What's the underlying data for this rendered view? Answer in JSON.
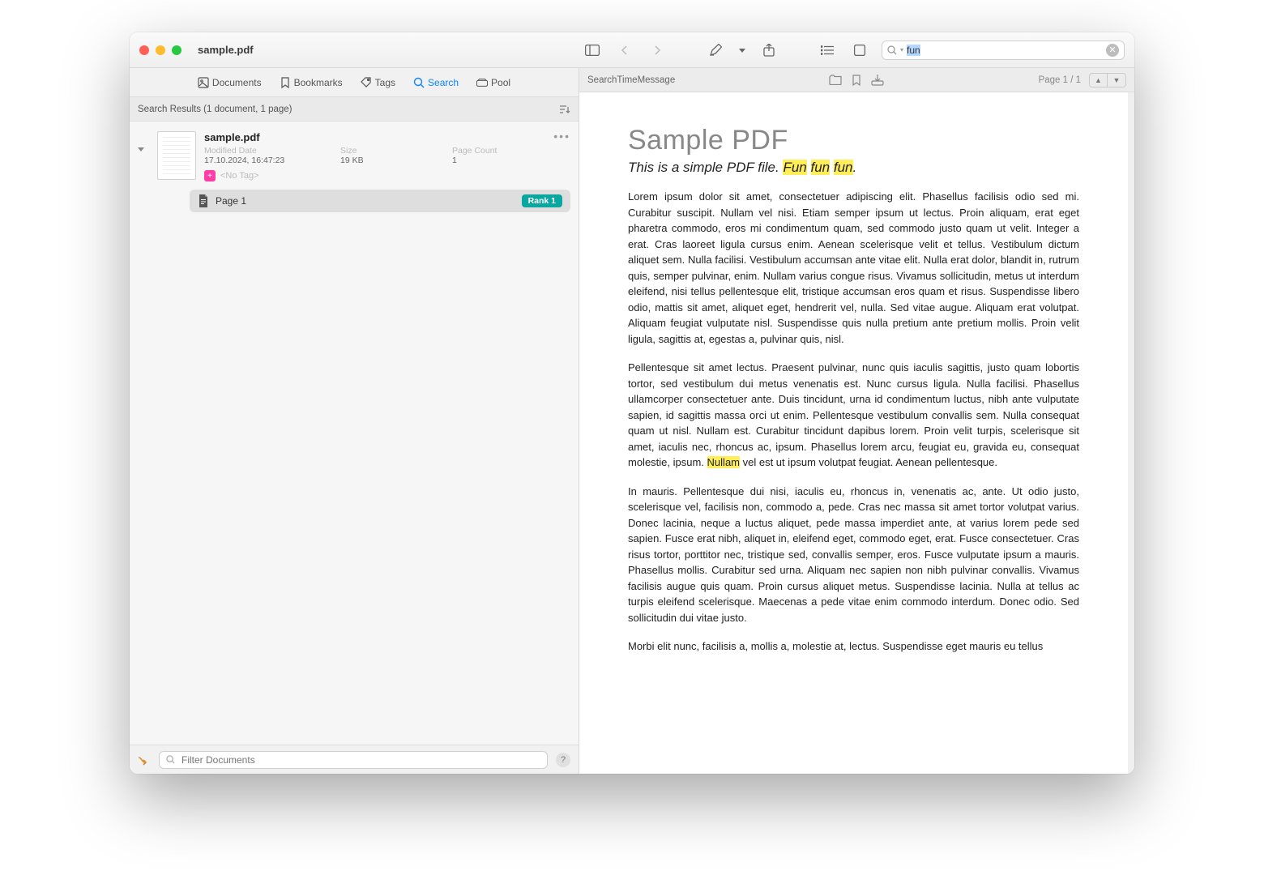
{
  "window": {
    "title": "sample.pdf"
  },
  "toolbar": {
    "search_value": "fun"
  },
  "left_tabs": {
    "documents": "Documents",
    "bookmarks": "Bookmarks",
    "tags": "Tags",
    "search": "Search",
    "pool": "Pool"
  },
  "search_results": {
    "header": "Search Results (1 document, 1 page)",
    "doc": {
      "name": "sample.pdf",
      "mod_label": "Modified Date",
      "mod_value": "17.10.2024, 16:47:23",
      "size_label": "Size",
      "size_value": "19 KB",
      "pagecount_label": "Page Count",
      "pagecount_value": "1",
      "no_tag": "<No Tag>"
    },
    "page_row": {
      "label": "Page 1",
      "rank": "Rank 1"
    }
  },
  "left_footer": {
    "filter_placeholder": "Filter Documents"
  },
  "doc_toolbar": {
    "search_time": "SearchTimeMessage",
    "page_indicator": "Page 1 / 1"
  },
  "document": {
    "title": "Sample PDF",
    "subtitle_prefix": "This is a simple PDF file. ",
    "subtitle_hl1": "Fun",
    "subtitle_sp1": " ",
    "subtitle_hl2": "fun",
    "subtitle_sp2": " ",
    "subtitle_hl3": "fun",
    "subtitle_suffix": ".",
    "p1a": "Lorem ipsum dolor sit amet, consectetuer adipiscing elit. Phasellus facilisis odio sed mi. Curabitur suscipit. Nullam vel nisi. Etiam semper ipsum ut lectus. Proin aliquam, erat eget pharetra commodo, eros mi condimentum quam, sed commodo justo quam ut velit. Integer a erat. Cras laoreet ligula cursus enim. Aenean scelerisque velit et tellus. Vestibulum dictum aliquet sem. Nulla facilisi. Vestibulum accumsan ante vitae elit. Nulla erat dolor, blandit in, rutrum quis, semper pulvinar, enim. Nullam varius congue risus. Vivamus sollicitudin, metus ut interdum eleifend, nisi tellus pellentesque elit, tristique accumsan eros quam et risus. Suspendisse libero odio, mattis sit amet, aliquet eget, hendrerit vel, nulla. Sed vitae augue. Aliquam erat volutpat. Aliquam feugiat vulputate nisl. Suspendisse quis nulla pretium ante pretium mollis. Proin velit ligula, sagittis at, egestas a, pulvinar quis, nisl.",
    "p2a": "Pellentesque sit amet lectus. Praesent pulvinar, nunc quis iaculis sagittis, justo quam lobortis tortor, sed vestibulum dui metus venenatis est. Nunc cursus ligula. Nulla facilisi. Phasellus ullamcorper consectetuer ante. Duis tincidunt, urna id condimentum luctus, nibh ante vulputate sapien, id sagittis massa orci ut enim. Pellentesque vestibulum convallis sem. Nulla consequat quam ut nisl. Nullam est. Curabitur tincidunt dapibus lorem. Proin velit turpis, scelerisque sit amet, iaculis nec, rhoncus ac, ipsum. Phasellus lorem arcu, feugiat eu, gravida eu, consequat molestie, ipsum. ",
    "p2_hl": "Nullam",
    "p2b": " vel est ut ipsum volutpat feugiat. Aenean pellentesque.",
    "p3": "In mauris. Pellentesque dui nisi, iaculis eu, rhoncus in, venenatis ac, ante. Ut odio justo, scelerisque vel, facilisis non, commodo a, pede. Cras nec massa sit amet tortor volutpat varius. Donec lacinia, neque a luctus aliquet, pede massa imperdiet ante, at varius lorem pede sed sapien. Fusce erat nibh, aliquet in, eleifend eget, commodo eget, erat. Fusce consectetuer. Cras risus tortor, porttitor nec, tristique sed, convallis semper, eros. Fusce vulputate ipsum a mauris. Phasellus mollis. Curabitur sed urna. Aliquam nec sapien non nibh pulvinar convallis. Vivamus facilisis augue quis quam. Proin cursus aliquet metus. Suspendisse lacinia. Nulla at tellus ac turpis eleifend scelerisque. Maecenas a pede vitae enim commodo interdum. Donec odio. Sed sollicitudin dui vitae justo.",
    "p4": "Morbi elit nunc, facilisis a, mollis a, molestie at, lectus. Suspendisse eget mauris eu tellus"
  }
}
